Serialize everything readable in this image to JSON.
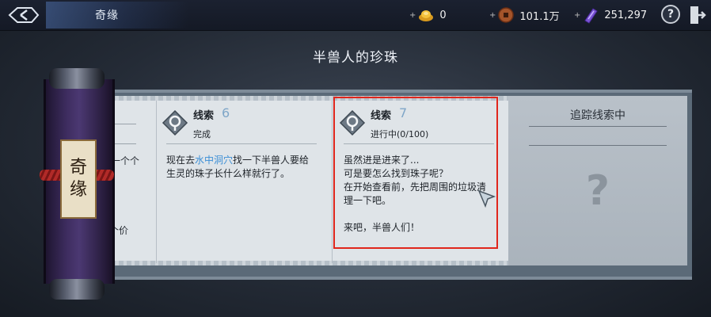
{
  "header": {
    "title": "奇缘",
    "resources": [
      {
        "name": "gold-ingot",
        "plus": "+",
        "value": "0"
      },
      {
        "name": "copper-coin",
        "plus": "+",
        "value": "101.1万"
      },
      {
        "name": "purple-crystal",
        "plus": "+",
        "value": "251,297"
      }
    ],
    "help_label": "?"
  },
  "page_title": "半兽人的珍珠",
  "scroll": {
    "chars": [
      "奇",
      "缘"
    ]
  },
  "left_partial": {
    "line1": "一个个",
    "line2": "个价"
  },
  "clue6": {
    "title": "线索",
    "number": "6",
    "status": "完成",
    "body_before": "现在去",
    "body_highlight": "水中洞穴",
    "body_after": "找一下半兽人要给\n生灵的珠子长什么样就行了。"
  },
  "clue7": {
    "title": "线索",
    "number": "7",
    "status": "进行中(0/100)",
    "body": "虽然进是进来了...\n可是要怎么找到珠子呢？\n在开始查看前，先把周围的垃圾清\n理一下吧。\n\n来吧，半兽人们！"
  },
  "tracking": {
    "title": "追踪线索中",
    "mark": "?"
  },
  "colors": {
    "highlight_border": "#e0261c",
    "location_text": "#3c8fd6",
    "clue_number": "#7fa6c8"
  }
}
